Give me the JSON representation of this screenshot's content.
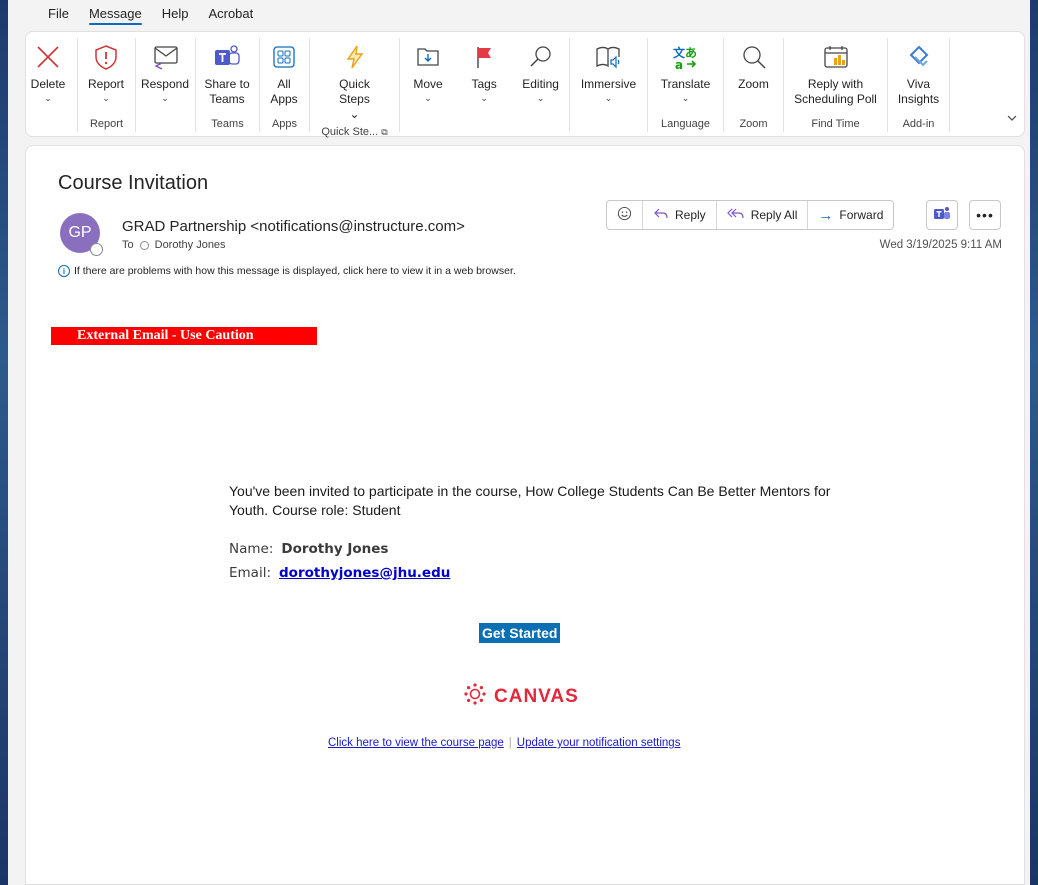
{
  "menu": [
    "File",
    "Message",
    "Help",
    "Acrobat"
  ],
  "ribbon": {
    "groups": [
      {
        "label": "",
        "buttons": [
          {
            "label": "Delete",
            "chev": true
          }
        ]
      },
      {
        "label": "Report",
        "buttons": [
          {
            "label": "Report",
            "chev": true
          }
        ]
      },
      {
        "label": "",
        "buttons": [
          {
            "label": "Respond",
            "chev": true
          }
        ]
      },
      {
        "label": "Teams",
        "buttons": [
          {
            "label": "Share to Teams"
          }
        ]
      },
      {
        "label": "Apps",
        "buttons": [
          {
            "label": "All Apps"
          }
        ]
      },
      {
        "label": "Quick Ste...",
        "buttons": [
          {
            "label": "Quick Steps ⌄"
          }
        ]
      },
      {
        "label": "",
        "buttons": [
          {
            "label": "Move",
            "chev": true
          },
          {
            "label": "Tags",
            "chev": true
          },
          {
            "label": "Editing",
            "chev": true
          }
        ]
      },
      {
        "label": "",
        "buttons": [
          {
            "label": "Immersive",
            "chev": true
          }
        ]
      },
      {
        "label": "Language",
        "buttons": [
          {
            "label": "Translate",
            "chev": true
          }
        ]
      },
      {
        "label": "Zoom",
        "buttons": [
          {
            "label": "Zoom"
          }
        ]
      },
      {
        "label": "Find Time",
        "buttons": [
          {
            "label": "Reply with Scheduling Poll"
          }
        ]
      },
      {
        "label": "Add-in",
        "buttons": [
          {
            "label": "Viva Insights"
          }
        ]
      }
    ]
  },
  "email": {
    "subject": "Course Invitation",
    "avatar_initials": "GP",
    "sender": "GRAD Partnership <notifications@instructure.com>",
    "to_prefix": "To",
    "to_name": "Dorothy Jones",
    "info": "If there are problems with how this message is displayed, click here to view it in a web browser.",
    "date": "Wed 3/19/2025 9:11 AM",
    "actions": {
      "reply": "Reply",
      "reply_all": "Reply All",
      "forward": "Forward"
    },
    "caution": "External Email - Use Caution",
    "body_line": "You've been invited to participate in the course, How College Students Can Be Better Mentors for Youth. Course role: Student",
    "name_label": "Name:",
    "name_value": "Dorothy Jones",
    "email_label": "Email:",
    "email_value": "dorothyjones@jhu.edu",
    "cta": "Get Started",
    "brand": "CANVAS",
    "link_course": "Click here to view the course page",
    "link_settings": "Update your notification settings",
    "link_separator": "|"
  },
  "colors": {
    "accent": "#0f6cbd",
    "avatar": "#8b6fbf",
    "caution": "#ff0000",
    "canvas": "#e4283b",
    "cta": "#0a6fb3"
  }
}
